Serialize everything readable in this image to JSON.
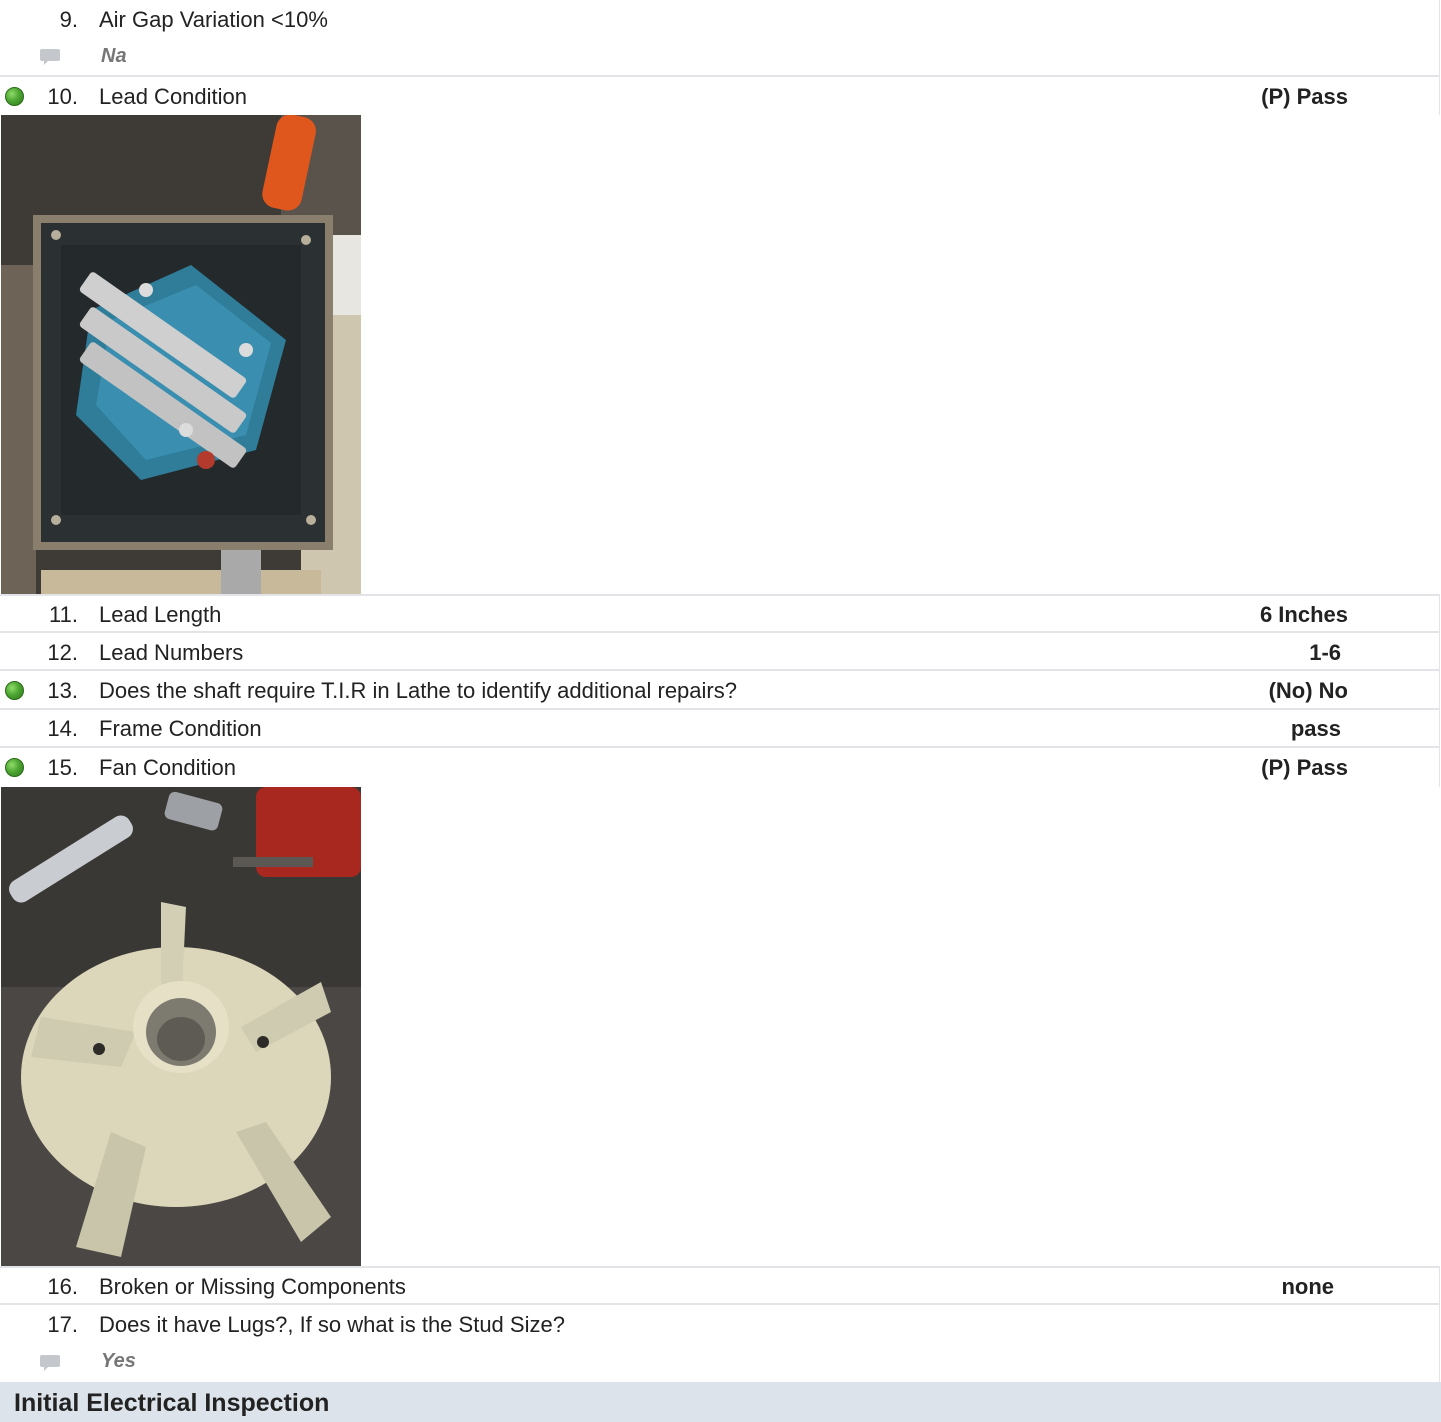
{
  "items": [
    {
      "number": "9.",
      "label": "Air Gap Variation <10%",
      "comment": "Na"
    },
    {
      "number": "10.",
      "label": "Lead Condition",
      "value": "(P) Pass",
      "status": "pass"
    },
    {
      "number": "11.",
      "label": "Lead Length",
      "value": "6 Inches"
    },
    {
      "number": "12.",
      "label": "Lead Numbers",
      "value": "1-6"
    },
    {
      "number": "13.",
      "label": "Does the shaft require T.I.R in Lathe to identify additional repairs?",
      "value": "(No) No",
      "status": "pass"
    },
    {
      "number": "14.",
      "label": "Frame Condition",
      "value": "pass"
    },
    {
      "number": "15.",
      "label": "Fan Condition",
      "value": "(P) Pass",
      "status": "pass"
    },
    {
      "number": "16.",
      "label": "Broken or Missing Components",
      "value": "none"
    },
    {
      "number": "17.",
      "label": "Does it have Lugs?, If so what is the Stud Size?",
      "comment": "Yes"
    }
  ],
  "section": {
    "title": "Initial Electrical Inspection"
  },
  "colors": {
    "status_dot": "#4ea632",
    "row_border": "#e2e4e8",
    "section_bg": "#dde3ea",
    "comment_text": "#777777"
  }
}
